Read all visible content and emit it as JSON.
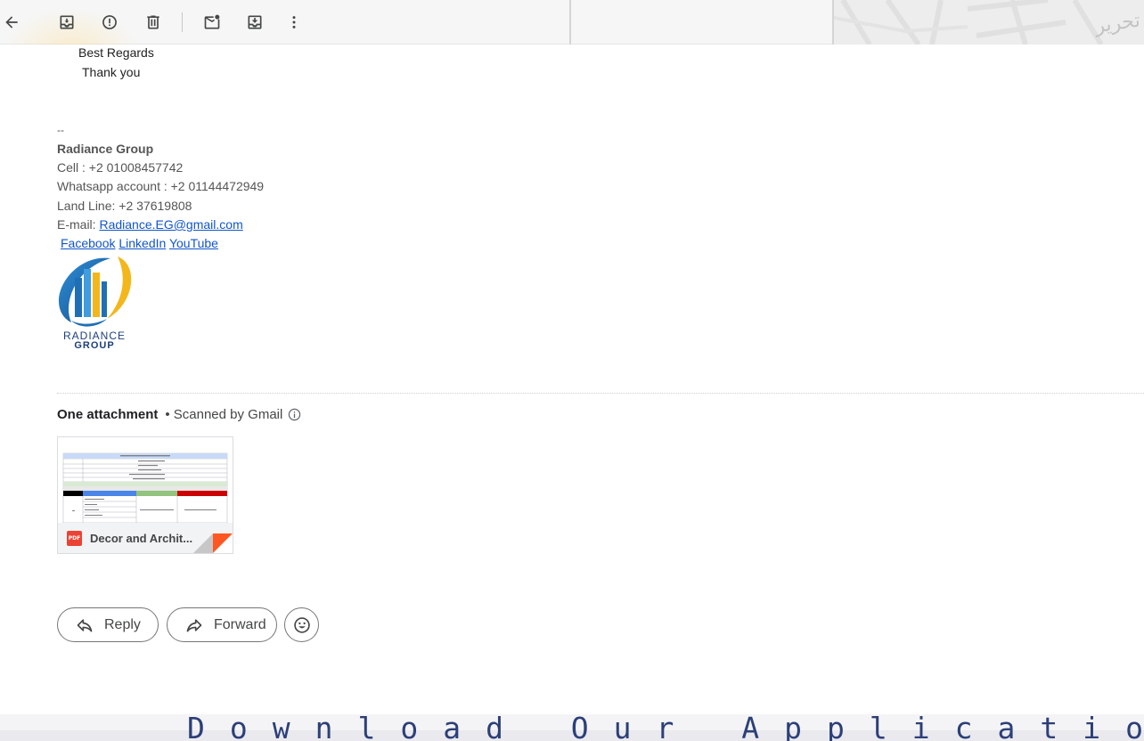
{
  "toolbar": {
    "icons": [
      "back-arrow-icon",
      "archive-icon",
      "report-spam-icon",
      "delete-icon",
      "mark-unread-icon",
      "move-to-icon",
      "more-vert-icon"
    ],
    "side_overlay_text": "تحرير"
  },
  "message": {
    "closing": "Best Regards",
    "thanks": "Thank you"
  },
  "signature": {
    "dashes": "--",
    "company": "Radiance Group",
    "cell": "Cell : +2 01008457742",
    "whatsapp": "Whatsapp account : +2 01144472949",
    "landline": "Land Line: +2 37619808",
    "email_label": "E-mail: ",
    "email": "Radiance.EG@gmail.com",
    "links": [
      "Facebook",
      "LinkedIn",
      "YouTube "
    ],
    "logo_text": [
      "RADIANCE",
      "GROUP"
    ],
    "logo_colors": {
      "blue": "#1f6fb5",
      "yellow": "#f3b71c",
      "navy": "#1c3f7c"
    }
  },
  "attachments": {
    "title": "One attachment",
    "scanned": "• Scanned by Gmail",
    "files": [
      {
        "name": "Decor and Archit...",
        "type": "PDF"
      }
    ]
  },
  "actions": {
    "reply": "Reply",
    "forward": "Forward"
  },
  "banner": {
    "text": "Download Our Application"
  },
  "colors": {
    "link": "#1155cc",
    "pdf_red": "#ea4335",
    "banner_text": "#2c3f78"
  }
}
